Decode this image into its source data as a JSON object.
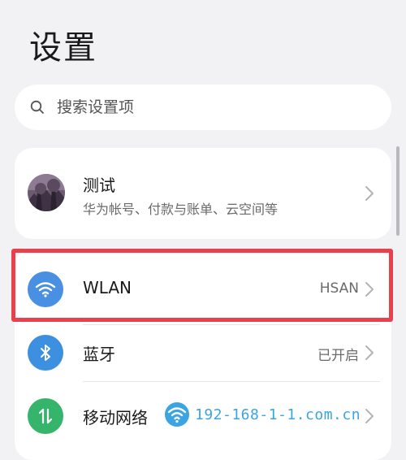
{
  "page": {
    "title": "设置"
  },
  "search": {
    "placeholder": "搜索设置项",
    "icon": "search-icon"
  },
  "account": {
    "name": "测试",
    "description": "华为帐号、付款与账单、云空间等",
    "avatar_icon": "avatar"
  },
  "settings": {
    "items": [
      {
        "label": "WLAN",
        "value": "HSAN",
        "icon": "wifi-icon",
        "icon_color": "#4a90e2"
      },
      {
        "label": "蓝牙",
        "value": "已开启",
        "icon": "bluetooth-icon",
        "icon_color": "#3d8fe0"
      },
      {
        "label": "移动网络",
        "value": "",
        "icon": "mobile-data-icon",
        "icon_color": "#35b46b"
      }
    ]
  },
  "highlight": {
    "color": "#e9414b"
  },
  "watermark": {
    "text": "192-168-1-1.com.cn"
  }
}
